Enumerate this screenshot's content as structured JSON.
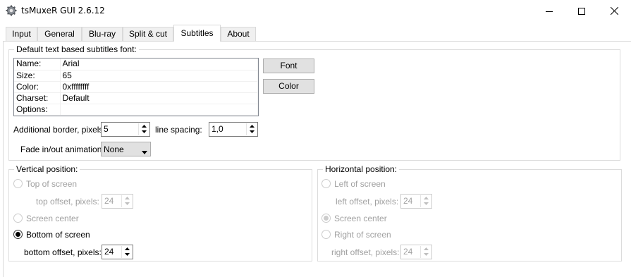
{
  "window": {
    "title": "tsMuxeR GUI 2.6.12",
    "icon": "gear-icon",
    "controls": [
      "minimize-icon",
      "maximize-icon",
      "close-icon"
    ]
  },
  "tabs": [
    {
      "label": "Input",
      "active": false
    },
    {
      "label": "General",
      "active": false
    },
    {
      "label": "Blu-ray",
      "active": false
    },
    {
      "label": "Split & cut",
      "active": false
    },
    {
      "label": "Subtitles",
      "active": true
    },
    {
      "label": "About",
      "active": false
    }
  ],
  "font_group": {
    "title": "Default text based subtitles font:",
    "rows": [
      {
        "key": "Name:",
        "value": "Arial"
      },
      {
        "key": "Size:",
        "value": "65"
      },
      {
        "key": "Color:",
        "value": "0xffffffff"
      },
      {
        "key": "Charset:",
        "value": "Default"
      },
      {
        "key": "Options:",
        "value": ""
      }
    ],
    "font_button": "Font",
    "color_button": "Color",
    "border_label": "Additional border, pixels:",
    "border_value": "5",
    "spacing_label": "line spacing:",
    "spacing_value": "1,0",
    "fade_label": "Fade in/out animation:",
    "fade_value": "None"
  },
  "vertical": {
    "title": "Vertical position:",
    "top_label": "Top of screen",
    "top_offset_label": "top offset, pixels:",
    "top_offset_value": "24",
    "center_label": "Screen center",
    "bottom_label": "Bottom of screen",
    "bottom_offset_label": "bottom offset, pixels:",
    "bottom_offset_value": "24",
    "selected": "bottom"
  },
  "horizontal": {
    "title": "Horizontal position:",
    "left_label": "Left of screen",
    "left_offset_label": "left offset, pixels:",
    "left_offset_value": "24",
    "center_label": "Screen center",
    "right_label": "Right of screen",
    "right_offset_label": "right offset, pixels:",
    "right_offset_value": "24",
    "selected": "center",
    "enabled": false
  },
  "colors": {
    "disabled_text": "#a0a0a0",
    "button_face": "#e1e1e1"
  }
}
